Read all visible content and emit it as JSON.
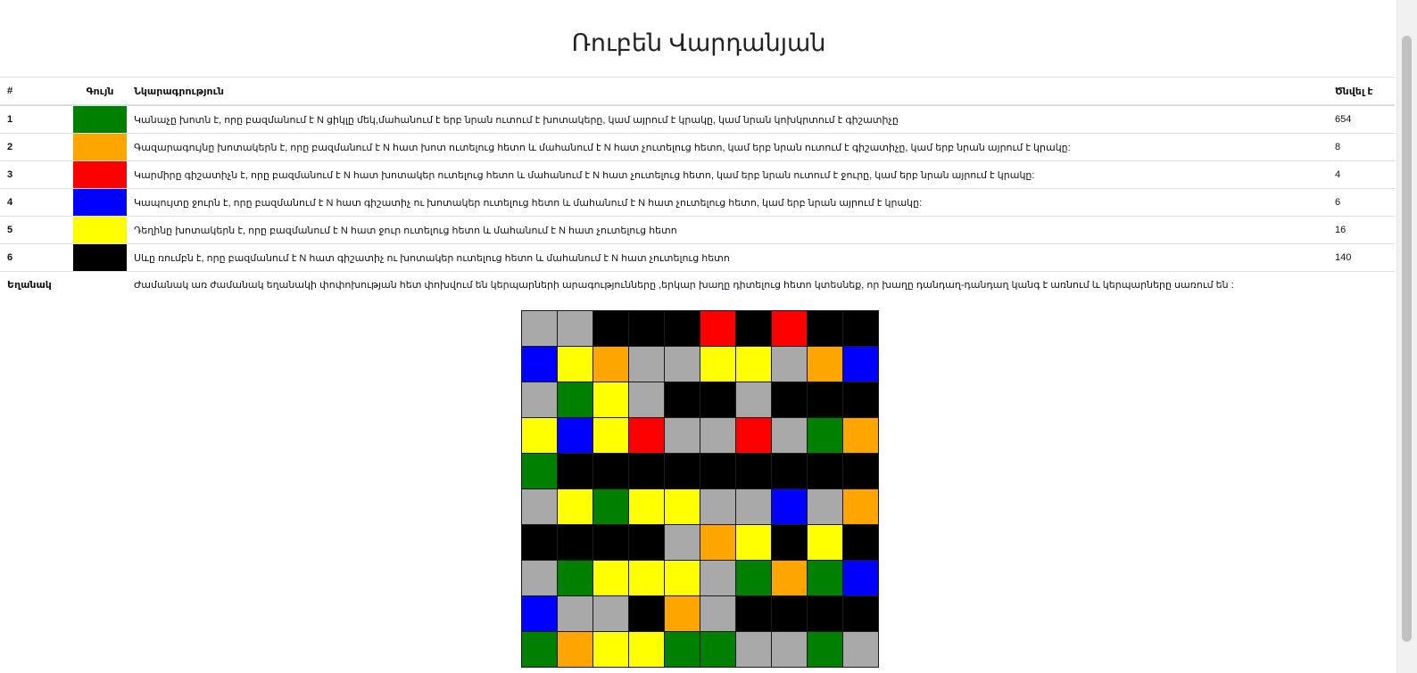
{
  "header": {
    "clipped_text": "",
    "title": "Ռուբեն Վարդանյան"
  },
  "legend": {
    "columns": {
      "index": "#",
      "color": "Գույն",
      "description": "Նկարագրություն",
      "born": "Ծնվել է"
    },
    "rows": [
      {
        "index": "1",
        "color": "#008000",
        "description": "Կանաչը խոտն է, որը բազմանում է N ցիկլը մեկ,մահանում է երբ նրան ուտում է խոտակերը, կամ այրում է կրակը, կամ նրան կոխկրտում է գիշատիչը",
        "born": "654"
      },
      {
        "index": "2",
        "color": "#FFA500",
        "description": "Գազարագույնը խոտակերն է, որը բազմանում է N հատ խոտ ուտելուց հետո և մահանում է N հատ չուտելուց հետո, կամ երբ նրան ուտում է գիշատիչը, կամ երբ նրան այրում է կրակը:",
        "born": "8"
      },
      {
        "index": "3",
        "color": "#FF0000",
        "description": "Կարմիրը գիշատիչն է, որը բազմանում է N հատ խոտակեր ուտելուց հետո և մահանում է N հատ չուտելուց հետո, կամ երբ նրան ուտում է ջուրը, կամ երբ նրան այրում է կրակը:",
        "born": "4"
      },
      {
        "index": "4",
        "color": "#0000FF",
        "description": "Կապույտը ջուրն է, որը բազմանում է N հատ գիշատիչ ու խոտակեր ուտելուց հետո և մահանում է N հատ չուտելուց հետո, կամ երբ նրան այրում է կրակը:",
        "born": "6"
      },
      {
        "index": "5",
        "color": "#FFFF00",
        "description": "Դեղինը խոտակերն է, որը բազմանում է N հատ ջուր ուտելուց հետո և մահանում է N հատ չուտելուց հետո",
        "born": "16"
      },
      {
        "index": "6",
        "color": "#000000",
        "description": "Սևը ռումբն է, որը բազմանում է N հատ գիշատիչ ու խոտակեր ուտելուց հետո և մահանում է N հատ չուտելուց հետո",
        "born": "140"
      }
    ],
    "note": {
      "label": "Եղանակ",
      "text": "Ժամանակ առ ժամանակ եղանակի փոփոխության հետ փոխվում են կերպարների արագությունները ,երկար խաղը դիտելուց հետո կտեսնեք, որ խաղը դանդաղ-դանդաղ կանգ է առնում և կերպարները սառում են :"
    }
  },
  "game_grid": {
    "palette": {
      "G": "#A9A9A9",
      "g": "#008000",
      "o": "#FFA500",
      "r": "#FF0000",
      "b": "#0000FF",
      "y": "#FFFF00",
      "k": "#000000"
    },
    "rows": [
      "GGkkkrkrkk",
      "byoGGyyGob",
      "GgyGkkGkkk",
      "ybyrGGrGgo",
      "gkkkkkkkkk",
      "GygyyGGbGo",
      "kkkkGoykyk",
      "GgyyyGgogb",
      "bGGkoGkkkk",
      "goyyggGGgG"
    ]
  }
}
